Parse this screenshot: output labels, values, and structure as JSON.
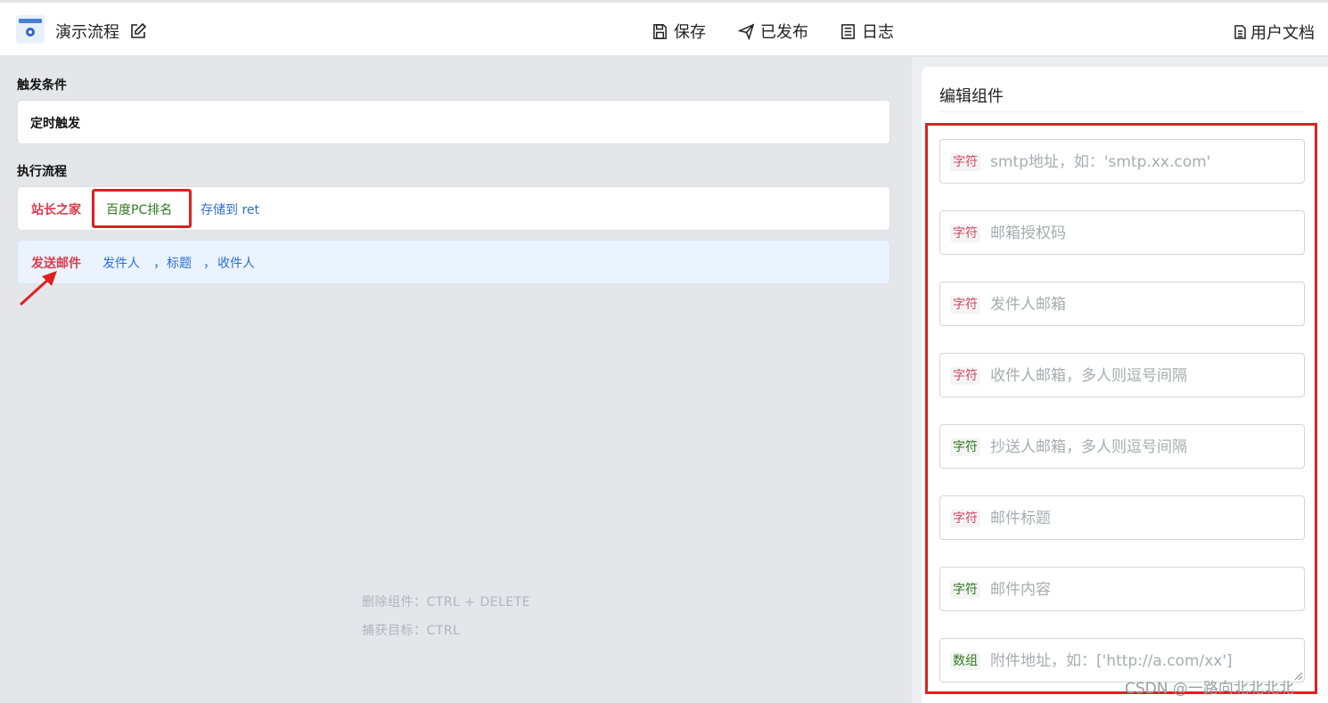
{
  "header": {
    "title": "演示流程",
    "save_label": "保存",
    "publish_label": "已发布",
    "log_label": "日志",
    "docs_label": "用户文档"
  },
  "trigger": {
    "section_label": "触发条件",
    "value": "定时触发"
  },
  "flow": {
    "section_label": "执行流程",
    "steps": [
      {
        "items": [
          "站长之家",
          "百度PC排名",
          "存储到 ret"
        ]
      },
      {
        "items": [
          "发送邮件",
          "发件人",
          "，",
          "标题",
          "，",
          "收件人"
        ]
      }
    ]
  },
  "hints": {
    "delete": "删除组件：CTRL + DELETE",
    "capture": "捕获目标：CTRL"
  },
  "editor": {
    "title": "编辑组件",
    "fields": [
      {
        "tag": "字符",
        "placeholder": "smtp地址，如：'smtp.xx.com'"
      },
      {
        "tag": "字符",
        "placeholder": "邮箱授权码"
      },
      {
        "tag": "字符",
        "placeholder": "发件人邮箱"
      },
      {
        "tag": "字符",
        "placeholder": "收件人邮箱，多人则逗号间隔"
      },
      {
        "tag": "字符",
        "placeholder": "抄送人邮箱，多人则逗号间隔"
      },
      {
        "tag": "字符",
        "placeholder": "邮件标题"
      },
      {
        "tag": "字符",
        "placeholder": "邮件内容"
      },
      {
        "tag": "数组",
        "placeholder": "附件地址，如：['http://a.com/xx']"
      }
    ]
  },
  "watermark": "CSDN @一路向北北北北",
  "colors": {
    "accent_red": "#d83b4c",
    "accent_green": "#2f7a1f",
    "accent_blue": "#2d6fcf",
    "annotation_red": "#e02020"
  }
}
